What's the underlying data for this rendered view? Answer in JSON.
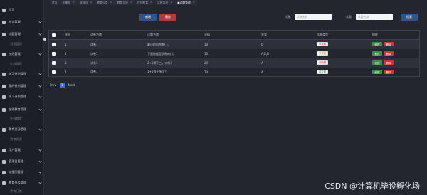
{
  "sidebar": {
    "items": [
      {
        "label": "首页",
        "sub": false
      },
      {
        "label": "考试管理",
        "sub": false
      },
      {
        "label": "试题管理",
        "sub": false
      },
      {
        "label": "试题管理",
        "sub": true
      },
      {
        "label": "在线管理",
        "sub": false
      },
      {
        "label": "在线管理",
        "sub": true
      },
      {
        "label": "学习计划管理",
        "sub": false
      },
      {
        "label": "我的计划管理",
        "sub": false
      },
      {
        "label": "学习计划管理",
        "sub": false
      },
      {
        "label": "在线教育管理",
        "sub": false
      },
      {
        "label": "在线教育",
        "sub": true
      },
      {
        "label": "教育资源管理",
        "sub": false
      },
      {
        "label": "教育资源",
        "sub": true
      },
      {
        "label": "用户管理",
        "sub": false
      },
      {
        "label": "管理员管理",
        "sub": false
      },
      {
        "label": "轮播图管理",
        "sub": false
      },
      {
        "label": "教育分类管理",
        "sub": false
      },
      {
        "label": "教育分类",
        "sub": true
      }
    ]
  },
  "tabs": [
    {
      "label": "首页",
      "active": false
    },
    {
      "label": "轮播图",
      "active": false
    },
    {
      "label": "管理员",
      "active": false
    },
    {
      "label": "教育分类",
      "active": false
    },
    {
      "label": "教育资源",
      "active": false
    },
    {
      "label": "在线教育",
      "active": false
    },
    {
      "label": "试卷管理",
      "active": false
    },
    {
      "label": "●试题管理",
      "active": true
    }
  ],
  "toolbar": {
    "add_label": "新增",
    "delete_label": "删除",
    "search_label": "搜索",
    "field1_label": "试卷:",
    "field1_placeholder": "试卷名称",
    "field2_label": "试题:",
    "field2_placeholder": "试题名称"
  },
  "table": {
    "headers": [
      "序号",
      "试卷名称",
      "试题名称",
      "分值",
      "答案",
      "试题类型",
      "操作"
    ],
    "rows": [
      {
        "idx": "1",
        "paper": "试卷1",
        "question": "最小的自然数(  )。",
        "score": "30",
        "answer": "0",
        "type": "单选题",
        "type_color": "red"
      },
      {
        "idx": "2",
        "paper": "试卷1",
        "question": "下面数据是质数的(  )。",
        "score": "30",
        "answer": "A,B,D",
        "type": "多选题",
        "type_color": "orange"
      },
      {
        "idx": "3",
        "paper": "试卷1",
        "question": "2+1等于三，对吗?",
        "score": "20",
        "answer": "A",
        "type": "判断题",
        "type_color": "red"
      },
      {
        "idx": "4",
        "paper": "试卷1",
        "question": "1+1等于多少?",
        "score": "20",
        "answer": "A",
        "type": "填空题",
        "type_color": "green"
      }
    ],
    "edit_label": "修改",
    "delete_label": "删除"
  },
  "pager": {
    "prev": "Prev",
    "current": "1",
    "next": "Next"
  },
  "watermark": "CSDN @计算机毕设孵化场"
}
